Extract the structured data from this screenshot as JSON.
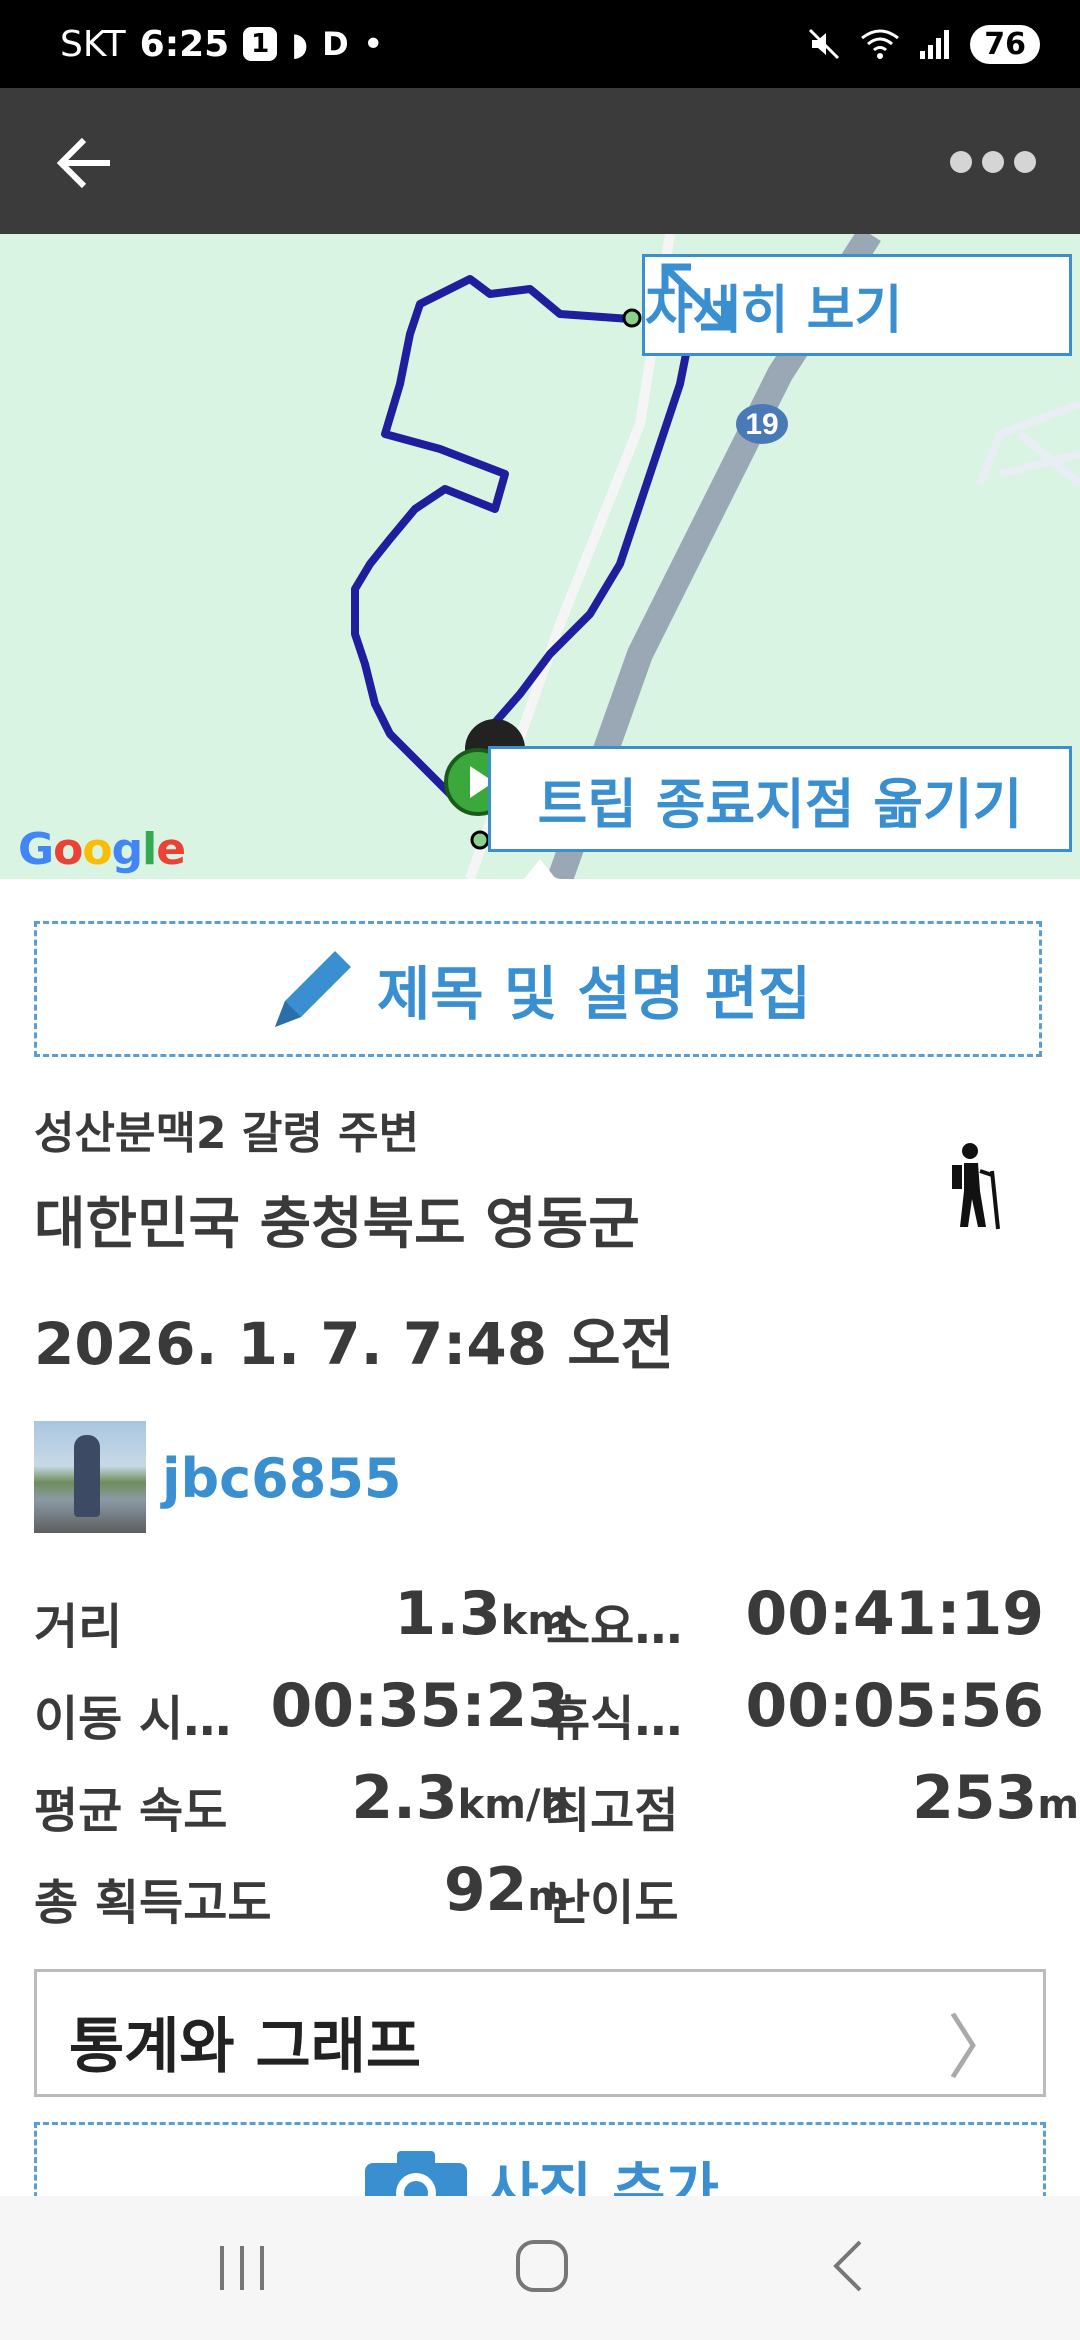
{
  "status_bar": {
    "carrier": "SKT",
    "time": "6:25",
    "notif_count": "1",
    "app_letter": "D",
    "battery": "76"
  },
  "app_bar": {
    "back_icon": "arrow-left-icon",
    "more_icon": "more-dots-icon"
  },
  "map": {
    "detail_label": "자세히 보기",
    "move_end_label": "트립 종료지점 옮기기",
    "route_number": "19",
    "google_logo": "Google",
    "route_color": "#1f1f9e"
  },
  "edit": {
    "label": "제목 및 설명 편집"
  },
  "trip": {
    "subtitle": "성산분맥2 갈령 주변",
    "location": "대한민국 충청북도 영동군",
    "date": "2026. 1. 7. 7:48 오전",
    "activity_icon": "hiking-icon"
  },
  "user": {
    "name": "jbc6855"
  },
  "stats": {
    "distance_label": "거리",
    "distance_value": "1.3",
    "distance_unit": "km",
    "total_time_label": "소요…",
    "total_time_value": "00:41:19",
    "moving_time_label": "이동 시…",
    "moving_time_value": "00:35:23",
    "rest_time_label": "휴식…",
    "rest_time_value": "00:05:56",
    "avg_speed_label": "평균 속도",
    "avg_speed_value": "2.3",
    "avg_speed_unit": "km/h",
    "max_alt_label": "최고점",
    "max_alt_value": "253",
    "max_alt_unit": "m",
    "total_ascent_label": "총 획득고도",
    "total_ascent_value": "92",
    "total_ascent_unit": "m",
    "difficulty_label": "난이도"
  },
  "graph_button": {
    "label": "통계와 그래프",
    "chevron": "〉"
  },
  "photo_button": {
    "label": "사진 추가"
  },
  "colors": {
    "accent": "#3a8fd1",
    "app_bar": "#3b3b3b",
    "map_bg": "#d9f4e3"
  }
}
